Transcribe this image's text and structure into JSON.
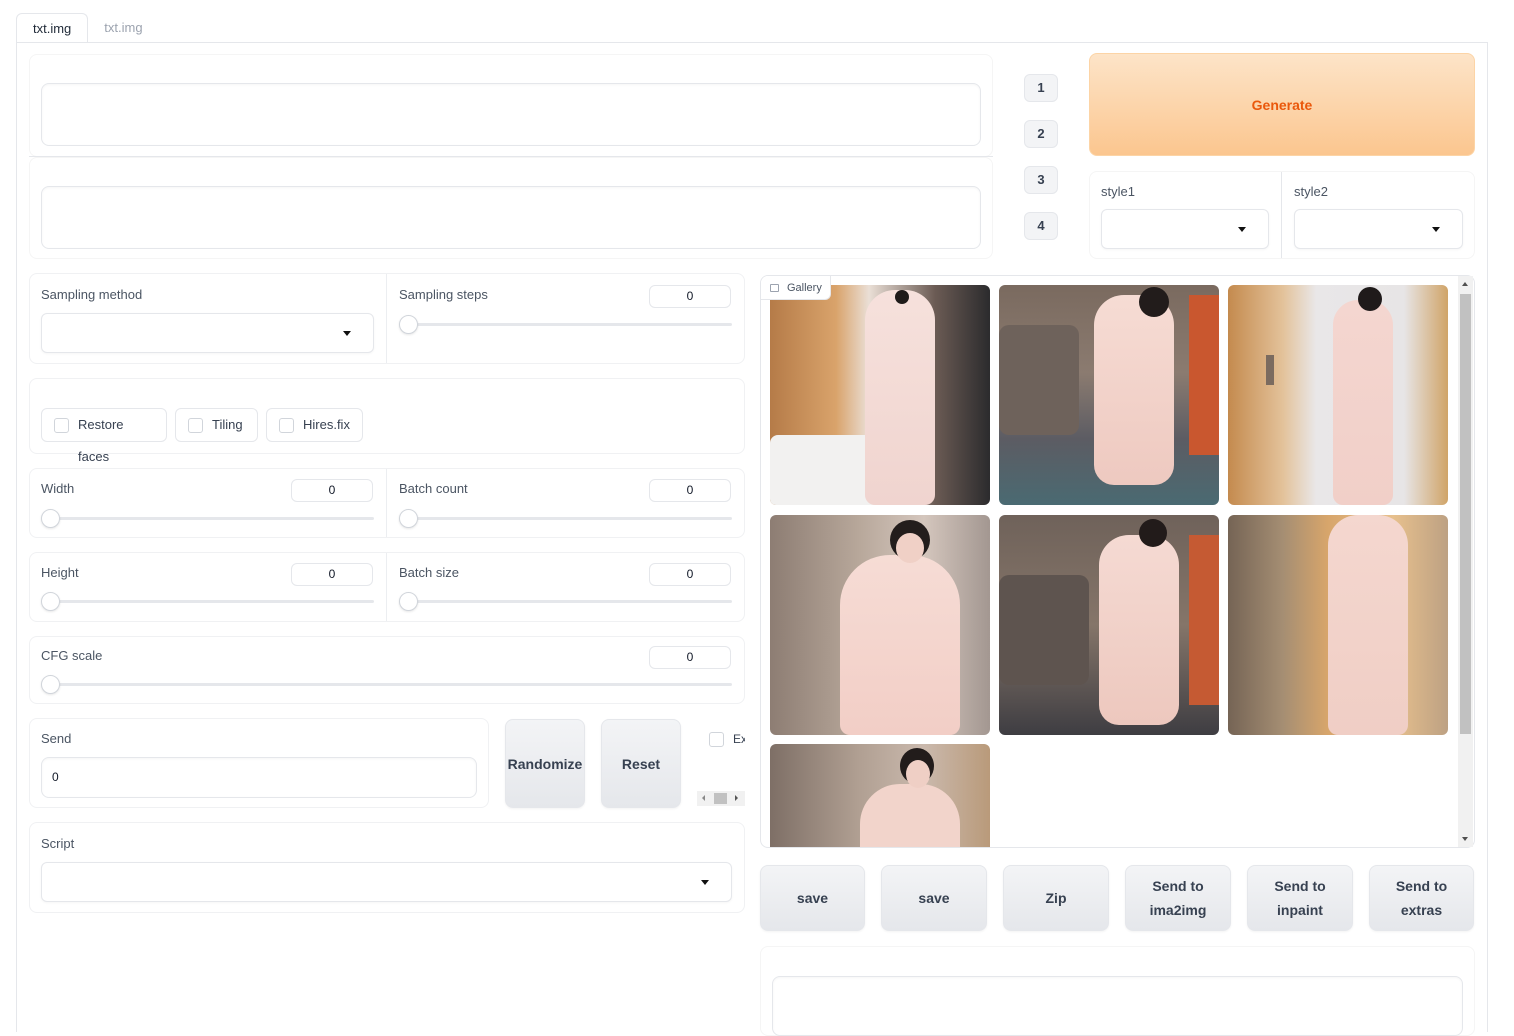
{
  "tabs": [
    {
      "label": "txt.img",
      "active": true
    },
    {
      "label": "txt.img",
      "active": false
    }
  ],
  "prompt": {
    "value": "",
    "negative_value": ""
  },
  "number_buttons": [
    "1",
    "2",
    "3",
    "4"
  ],
  "generate_label": "Generate",
  "styles": [
    {
      "label": "style1",
      "value": ""
    },
    {
      "label": "style2",
      "value": ""
    }
  ],
  "sampling_method": {
    "label": "Sampling method",
    "value": ""
  },
  "sampling_steps": {
    "label": "Sampling steps",
    "value": "0"
  },
  "checkboxes": [
    {
      "label": "Restore faces",
      "checked": false
    },
    {
      "label": "Tiling",
      "checked": false
    },
    {
      "label": "Hires.fix",
      "checked": false
    }
  ],
  "width": {
    "label": "Width",
    "value": "0"
  },
  "batch_count": {
    "label": "Batch count",
    "value": "0"
  },
  "height": {
    "label": "Height",
    "value": "0"
  },
  "batch_size": {
    "label": "Batch size",
    "value": "0"
  },
  "cfg_scale": {
    "label": "CFG scale",
    "value": "0"
  },
  "seed": {
    "label": "Send",
    "value": "0"
  },
  "randomize_label": "Randomize",
  "reset_label": "Reset",
  "extra_label": "Ex",
  "script": {
    "label": "Script",
    "value": ""
  },
  "gallery": {
    "label": "Gallery",
    "image_count": 7
  },
  "actions": {
    "save1": "save",
    "save2": "save",
    "zip": "Zip",
    "send_img2img_1": "Send to",
    "send_img2img_2": "ima2img",
    "send_inpaint_1": "Send to",
    "send_inpaint_2": "inpaint",
    "send_extras_1": "Send to",
    "send_extras_2": "extras"
  },
  "colors": {
    "accent": "#ea580c",
    "generate_top": "#fde4c8",
    "generate_bottom": "#fbc68f"
  }
}
